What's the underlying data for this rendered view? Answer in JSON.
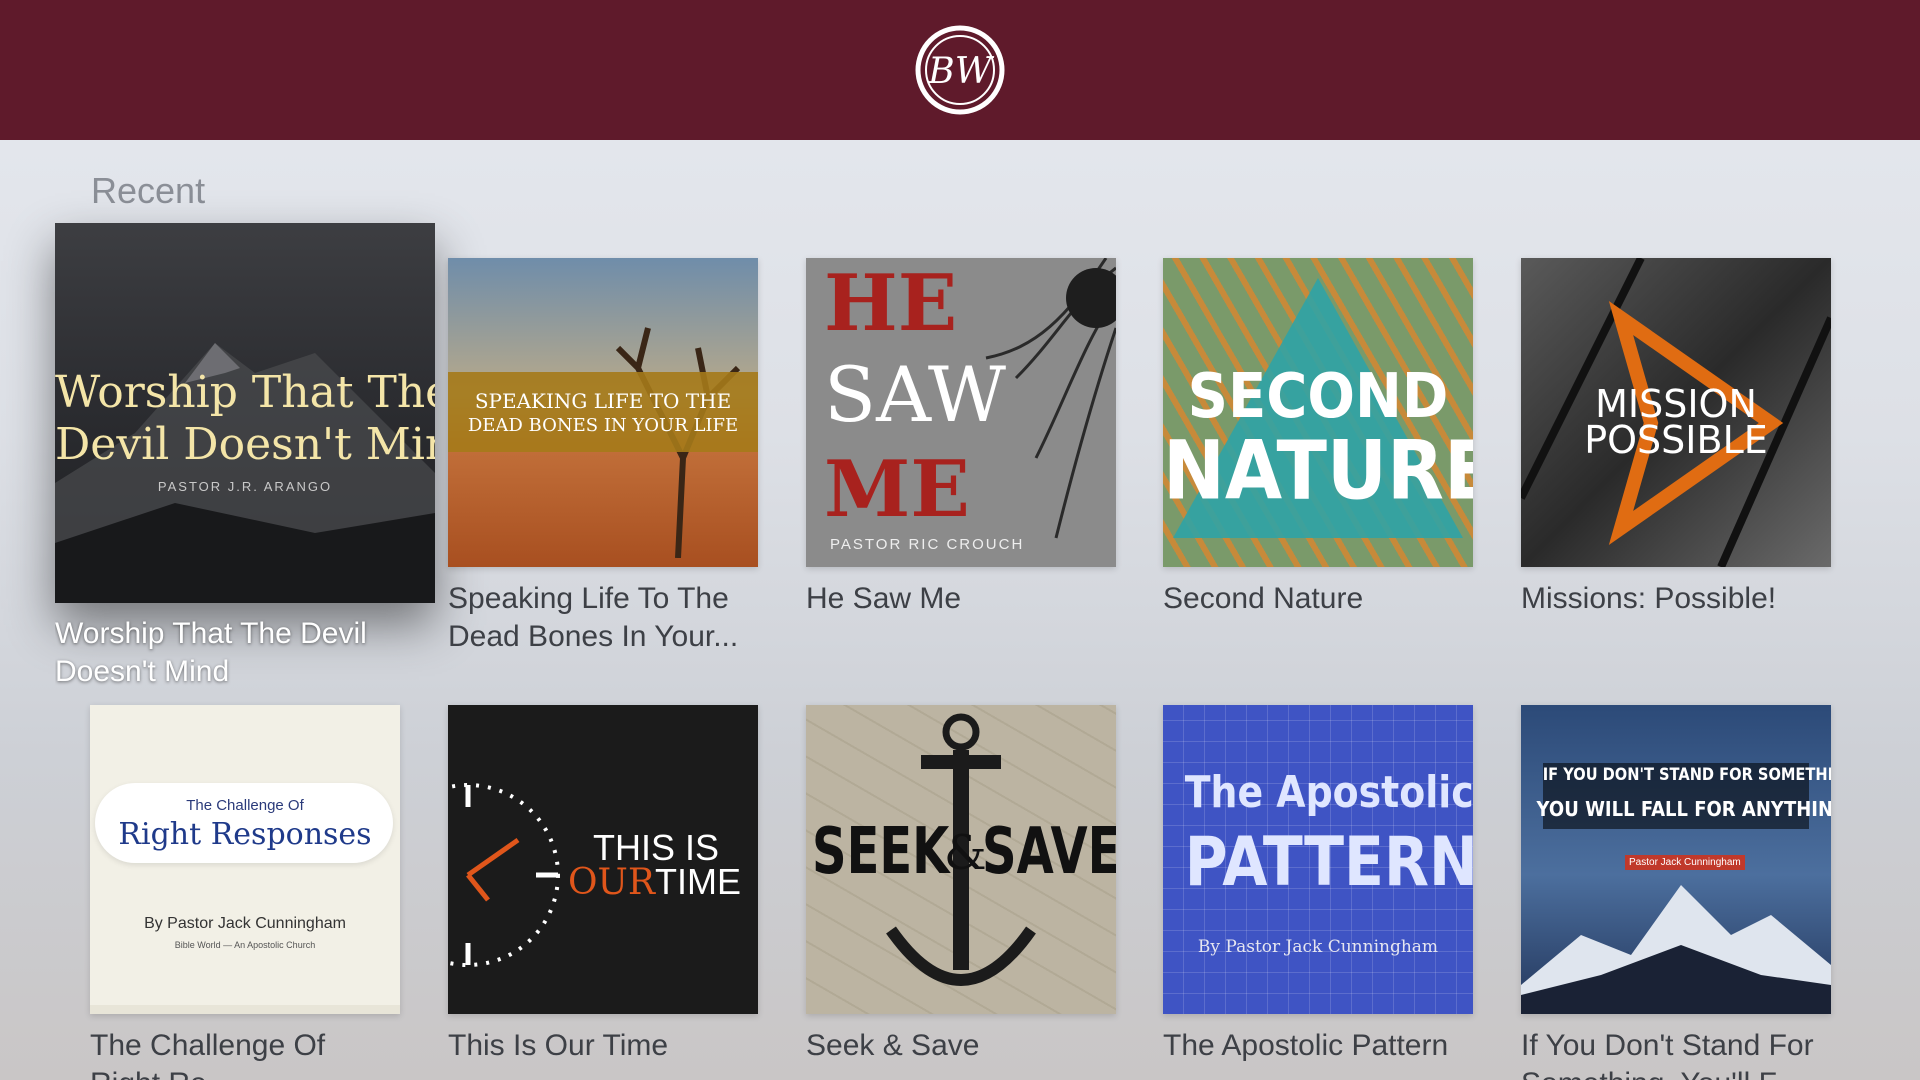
{
  "header": {
    "logo_text": "BW"
  },
  "section": {
    "title": "Recent"
  },
  "items": [
    {
      "title": "Worship That The Devil Doesn't Mind",
      "caption_line1": "Worship That The Devil",
      "caption_line2": "Doesn't Mind",
      "art_line1": "Worship That The",
      "art_line2": "Devil Doesn't Mind",
      "art_sub": "PASTOR J.R. ARANGO"
    },
    {
      "title": "Speaking Life To The Dead Bones In Your Life",
      "caption_line1": "Speaking Life To The",
      "caption_line2": "Dead Bones In Your...",
      "art_line1": "SPEAKING LIFE TO THE",
      "art_line2": "DEAD BONES IN YOUR LIFE"
    },
    {
      "title": "He Saw Me",
      "caption_line1": "He Saw Me",
      "art_line1": "HE",
      "art_line2": "SAW",
      "art_line3": "ME",
      "art_sub": "PASTOR RIC CROUCH"
    },
    {
      "title": "Second Nature",
      "caption_line1": "Second Nature",
      "art_line1": "SECOND",
      "art_line2": "NATURE"
    },
    {
      "title": "Missions: Possible!",
      "caption_line1": "Missions: Possible!",
      "art_line1": "MISSION",
      "art_line2": "POSSIBLE"
    },
    {
      "title": "The Challenge Of Right Responses",
      "caption_line1": "The Challenge Of",
      "caption_line2": "Right Re...",
      "art_line1": "The Challenge Of",
      "art_line2": "Right Responses",
      "art_sub": "By Pastor Jack Cunningham",
      "art_sub2": "Bible World — An Apostolic Church"
    },
    {
      "title": "This Is Our Time",
      "caption_line1": "This Is Our Time",
      "art_line1": "THIS IS",
      "art_line2a": "OUR",
      "art_line2b": "TIME"
    },
    {
      "title": "Seek & Save",
      "caption_line1": "Seek & Save",
      "art_line1": "SEEK",
      "art_amp": "&",
      "art_line2": "SAVE"
    },
    {
      "title": "The Apostolic Pattern",
      "caption_line1": "The Apostolic Pattern",
      "art_line1": "The Apostolic",
      "art_line2": "PATTERN",
      "art_sub": "By Pastor Jack Cunningham"
    },
    {
      "title": "If You Don't Stand For Something, You'll Fall For Anything",
      "caption_line1": "If You Don't Stand For",
      "caption_line2": "Something, You'll F...",
      "art_line1": "IF YOU DON'T STAND FOR SOMETHING,",
      "art_line2": "YOU WILL FALL FOR ANYTHING.",
      "art_sub": "Pastor Jack Cunningham"
    }
  ],
  "colors": {
    "header": "#5f1a2b",
    "caption": "#3d4046"
  }
}
